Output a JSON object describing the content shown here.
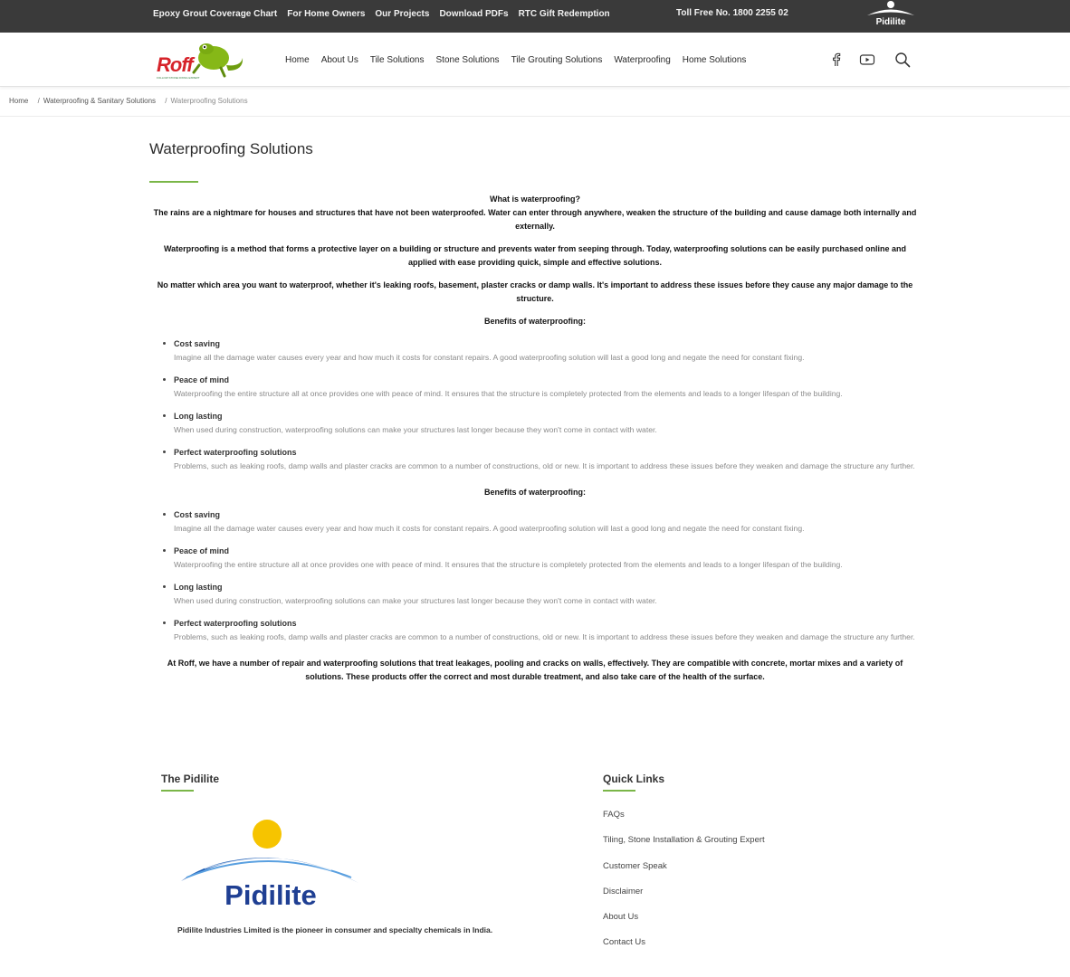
{
  "topbar": {
    "links": [
      "Epoxy Grout Coverage Chart",
      "For Home Owners",
      "Our Projects",
      "Download PDFs",
      "RTC Gift Redemption"
    ],
    "toll_free": "Toll Free No. 1800 2255 02",
    "brand": "Pidilite"
  },
  "header": {
    "logo_text": "Roff",
    "logo_tagline": "FOLLOW STONE FIXING EXPERT",
    "nav": [
      "Home",
      "About Us",
      "Tile Solutions",
      "Stone Solutions",
      "Tile Grouting Solutions",
      "Waterproofing",
      "Home Solutions"
    ],
    "icons": [
      "facebook-icon",
      "youtube-icon",
      "search-icon"
    ]
  },
  "breadcrumb": {
    "items": [
      "Home",
      "Waterproofing & Sanitary Solutions",
      "Waterproofing Solutions"
    ]
  },
  "main": {
    "title": "Waterproofing Solutions",
    "question": "What is waterproofing?",
    "paragraphs": [
      "The rains are a nightmare for houses and structures that have not been waterproofed. Water can enter through anywhere, weaken the structure of the building and cause damage both internally and externally.",
      "Waterproofing is a method that forms a protective layer on a building or structure and prevents water from seeping through. Today, waterproofing solutions can be easily purchased online and applied with ease providing quick, simple and effective solutions.",
      "No matter which area you want to waterproof, whether it's leaking roofs, basement, plaster cracks or damp walls. It's important to address these issues before they cause any major damage to the structure."
    ],
    "benefits_heading": "Benefits of waterproofing:",
    "benefits": [
      {
        "title": "Cost saving",
        "desc": "Imagine all the damage water causes every year and how much it costs for constant repairs. A good waterproofing solution will last a good long and negate the need for constant fixing."
      },
      {
        "title": "Peace of mind",
        "desc": "Waterproofing the entire structure all at once provides one with peace of mind. It ensures that the structure is completely protected from the elements and leads to a longer lifespan of the building."
      },
      {
        "title": "Long lasting",
        "desc": "When used during construction, waterproofing solutions can make your structures last longer because they won't come in contact with water."
      },
      {
        "title": "Perfect waterproofing solutions",
        "desc": "Problems, such as leaking roofs, damp walls and plaster cracks are common to a number of constructions, old or new. It is important to address these issues before they weaken and damage the structure any further."
      }
    ],
    "closing": "At Roff, we have a number of repair and waterproofing solutions that treat leakages, pooling and cracks on walls, effectively. They are compatible with concrete, mortar mixes and a variety of solutions. These products offer the correct and most durable treatment, and also take care of the health of the surface."
  },
  "footer": {
    "pidilite_heading": "The Pidilite",
    "pidilite_logo_text": "Pidilite",
    "pidilite_caption": "Pidilite Industries Limited is the pioneer in consumer and specialty chemicals in India.",
    "quick_links_heading": "Quick Links",
    "quick_links": [
      "FAQs",
      "Tiling, Stone Installation & Grouting Expert",
      "Customer Speak",
      "Disclaimer",
      "About Us",
      "Contact Us"
    ]
  },
  "colors": {
    "topbar_bg": "#3a3a3a",
    "accent_green": "#7ab648",
    "roff_red": "#d6232a",
    "pidilite_blue": "#1f3f93",
    "pidilite_sun": "#f6c400"
  }
}
